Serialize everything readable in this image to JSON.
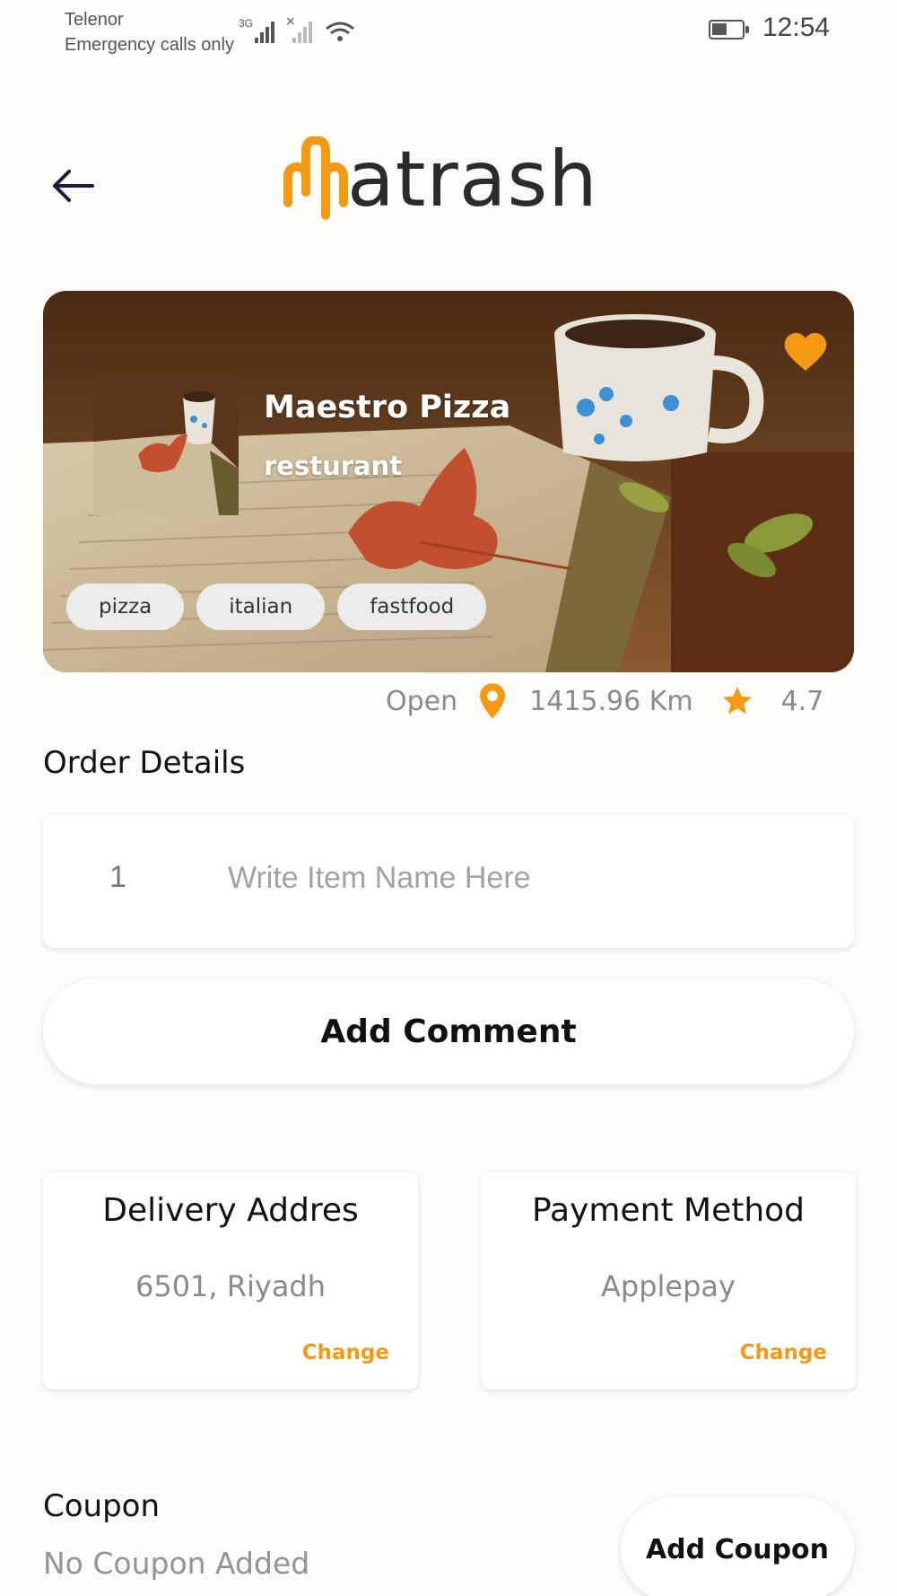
{
  "status_bar": {
    "carrier": "Telenor",
    "emergency": "Emergency calls only",
    "network": "3G",
    "time": "12:54"
  },
  "header": {
    "back_icon": "arrow-left-icon",
    "logo_text": "atrash"
  },
  "restaurant": {
    "name": "Maestro Pizza",
    "type": "resturant",
    "favorite_icon": "heart-icon",
    "tags": [
      "pizza",
      "italian",
      "fastfood"
    ],
    "status": "Open",
    "distance": "1415.96 Km",
    "rating": "4.7"
  },
  "order": {
    "title": "Order Details",
    "quantity": "1",
    "item_value": "",
    "item_placeholder": "Write Item Name Here",
    "comment_button": "Add Comment"
  },
  "delivery": {
    "title": "Delivery Addres",
    "value": "6501, Riyadh",
    "change_label": "Change"
  },
  "payment": {
    "title": "Payment Method",
    "value": "Applepay",
    "change_label": "Change"
  },
  "coupon": {
    "title": "Coupon",
    "status": "No Coupon Added",
    "button": "Add Coupon"
  },
  "colors": {
    "accent": "#f39a12",
    "background": "#fcfbf8",
    "text_dark": "#111111",
    "text_muted": "#8b8b8b"
  }
}
